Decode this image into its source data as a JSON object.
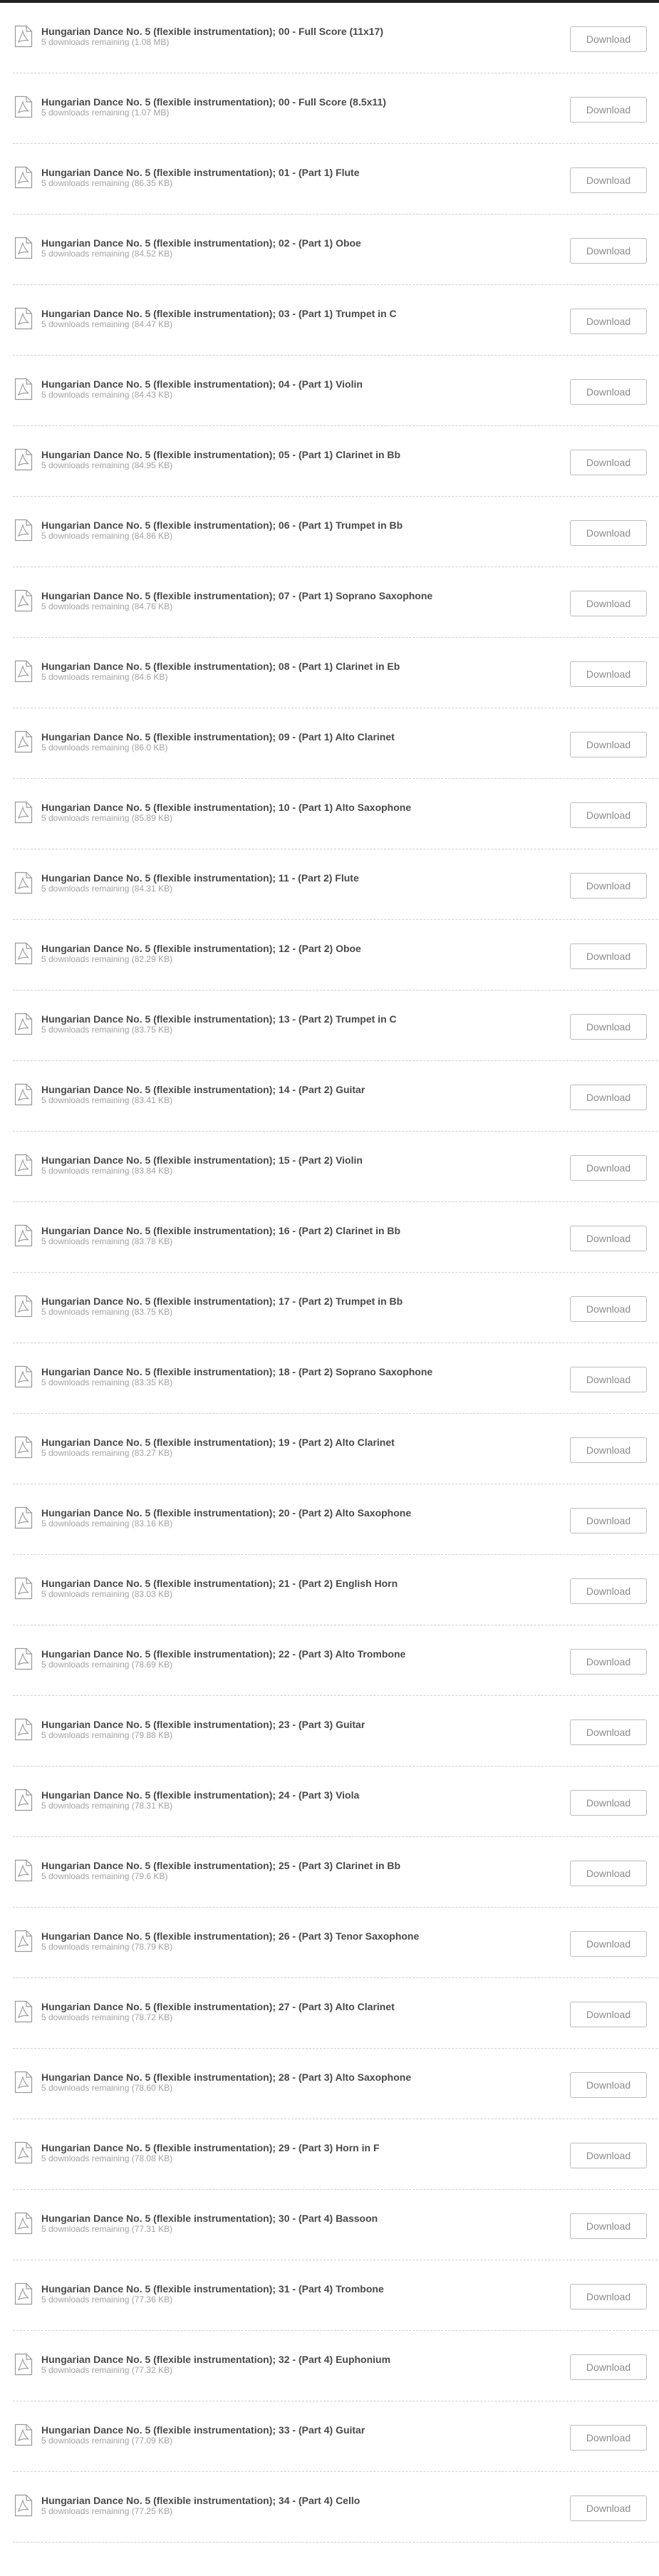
{
  "download_label": "Download",
  "items": [
    {
      "title": "Hungarian Dance No. 5 (flexible instrumentation); 00 - Full Score (11x17)",
      "meta": "5 downloads remaining (1.08 MB)"
    },
    {
      "title": "Hungarian Dance No. 5 (flexible instrumentation); 00 - Full Score (8.5x11)",
      "meta": "5 downloads remaining (1.07 MB)"
    },
    {
      "title": "Hungarian Dance No. 5 (flexible instrumentation); 01 - (Part 1) Flute",
      "meta": "5 downloads remaining (86.35 KB)"
    },
    {
      "title": "Hungarian Dance No. 5 (flexible instrumentation); 02 - (Part 1) Oboe",
      "meta": "5 downloads remaining (84.52 KB)"
    },
    {
      "title": "Hungarian Dance No. 5 (flexible instrumentation); 03 - (Part 1) Trumpet in C",
      "meta": "5 downloads remaining (84.47 KB)"
    },
    {
      "title": "Hungarian Dance No. 5 (flexible instrumentation); 04 - (Part 1) Violin",
      "meta": "5 downloads remaining (84.43 KB)"
    },
    {
      "title": "Hungarian Dance No. 5 (flexible instrumentation); 05 - (Part 1) Clarinet in Bb",
      "meta": "5 downloads remaining (84.95 KB)"
    },
    {
      "title": "Hungarian Dance No. 5 (flexible instrumentation); 06 - (Part 1) Trumpet in Bb",
      "meta": "5 downloads remaining (84.86 KB)"
    },
    {
      "title": "Hungarian Dance No. 5 (flexible instrumentation); 07 - (Part 1) Soprano Saxophone",
      "meta": "5 downloads remaining (84.76 KB)"
    },
    {
      "title": "Hungarian Dance No. 5 (flexible instrumentation); 08 - (Part 1) Clarinet in Eb",
      "meta": "5 downloads remaining (84.6 KB)"
    },
    {
      "title": "Hungarian Dance No. 5 (flexible instrumentation); 09 - (Part 1) Alto Clarinet",
      "meta": "5 downloads remaining (86.0 KB)"
    },
    {
      "title": "Hungarian Dance No. 5 (flexible instrumentation); 10 - (Part 1) Alto Saxophone",
      "meta": "5 downloads remaining (85.89 KB)"
    },
    {
      "title": "Hungarian Dance No. 5 (flexible instrumentation); 11 - (Part 2) Flute",
      "meta": "5 downloads remaining (84.31 KB)"
    },
    {
      "title": "Hungarian Dance No. 5 (flexible instrumentation); 12 - (Part 2) Oboe",
      "meta": "5 downloads remaining (82.29 KB)"
    },
    {
      "title": "Hungarian Dance No. 5 (flexible instrumentation); 13 - (Part 2) Trumpet in C",
      "meta": "5 downloads remaining (83.75 KB)"
    },
    {
      "title": "Hungarian Dance No. 5 (flexible instrumentation); 14 - (Part 2) Guitar",
      "meta": "5 downloads remaining (83.41 KB)"
    },
    {
      "title": "Hungarian Dance No. 5 (flexible instrumentation); 15 - (Part 2) Violin",
      "meta": "5 downloads remaining (83.84 KB)"
    },
    {
      "title": "Hungarian Dance No. 5 (flexible instrumentation); 16 - (Part 2) Clarinet in Bb",
      "meta": "5 downloads remaining (83.78 KB)"
    },
    {
      "title": "Hungarian Dance No. 5 (flexible instrumentation); 17 - (Part 2) Trumpet in Bb",
      "meta": "5 downloads remaining (83.75 KB)"
    },
    {
      "title": "Hungarian Dance No. 5 (flexible instrumentation); 18 - (Part 2) Soprano Saxophone",
      "meta": "5 downloads remaining (83.35 KB)"
    },
    {
      "title": "Hungarian Dance No. 5 (flexible instrumentation); 19 - (Part 2) Alto Clarinet",
      "meta": "5 downloads remaining (83.27 KB)"
    },
    {
      "title": "Hungarian Dance No. 5 (flexible instrumentation); 20 - (Part 2) Alto Saxophone",
      "meta": "5 downloads remaining (83.16 KB)"
    },
    {
      "title": "Hungarian Dance No. 5 (flexible instrumentation); 21 - (Part 2) English Horn",
      "meta": "5 downloads remaining (83.03 KB)"
    },
    {
      "title": "Hungarian Dance No. 5 (flexible instrumentation); 22 - (Part 3) Alto Trombone",
      "meta": "5 downloads remaining (78.69 KB)"
    },
    {
      "title": "Hungarian Dance No. 5 (flexible instrumentation); 23 - (Part 3) Guitar",
      "meta": "5 downloads remaining (79.88 KB)"
    },
    {
      "title": "Hungarian Dance No. 5 (flexible instrumentation); 24 - (Part 3) Viola",
      "meta": "5 downloads remaining (78.31 KB)"
    },
    {
      "title": "Hungarian Dance No. 5 (flexible instrumentation); 25 - (Part 3) Clarinet in Bb",
      "meta": "5 downloads remaining (79.6 KB)"
    },
    {
      "title": "Hungarian Dance No. 5 (flexible instrumentation); 26 - (Part 3) Tenor Saxophone",
      "meta": "5 downloads remaining (78.79 KB)"
    },
    {
      "title": "Hungarian Dance No. 5 (flexible instrumentation); 27 - (Part 3) Alto Clarinet",
      "meta": "5 downloads remaining (78.72 KB)"
    },
    {
      "title": "Hungarian Dance No. 5 (flexible instrumentation); 28 - (Part 3) Alto Saxophone",
      "meta": "5 downloads remaining (78.60 KB)"
    },
    {
      "title": "Hungarian Dance No. 5 (flexible instrumentation); 29 - (Part 3) Horn in F",
      "meta": "5 downloads remaining (78.08 KB)"
    },
    {
      "title": "Hungarian Dance No. 5 (flexible instrumentation); 30 - (Part 4) Bassoon",
      "meta": "5 downloads remaining (77.31 KB)"
    },
    {
      "title": "Hungarian Dance No. 5 (flexible instrumentation); 31 - (Part 4) Trombone",
      "meta": "5 downloads remaining (77.36 KB)"
    },
    {
      "title": "Hungarian Dance No. 5 (flexible instrumentation); 32 - (Part 4) Euphonium",
      "meta": "5 downloads remaining (77.32 KB)"
    },
    {
      "title": "Hungarian Dance No. 5 (flexible instrumentation); 33 - (Part 4) Guitar",
      "meta": "5 downloads remaining (77.09 KB)"
    },
    {
      "title": "Hungarian Dance No. 5 (flexible instrumentation); 34 - (Part 4) Cello",
      "meta": "5 downloads remaining (77.25 KB)"
    }
  ]
}
